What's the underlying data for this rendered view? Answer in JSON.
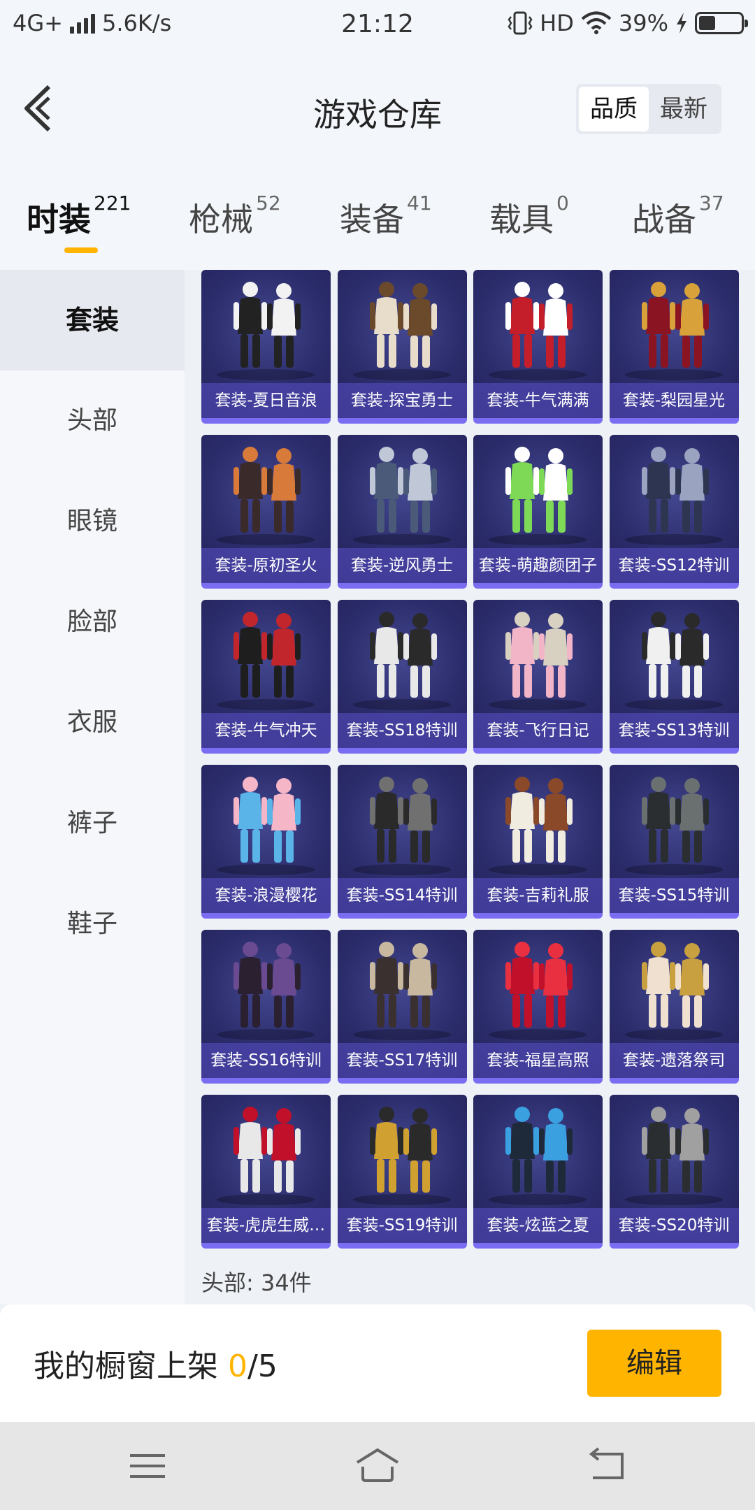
{
  "status_bar": {
    "network": "4G+",
    "speed": "5.6K/s",
    "time": "21:12",
    "hd": "HD",
    "battery": "39%",
    "battery_level": 0.39
  },
  "header": {
    "title": "游戏仓库",
    "sort_options": [
      "品质",
      "最新"
    ],
    "sort_active": "品质"
  },
  "tabs": [
    {
      "label": "时装",
      "count": "221",
      "active": true
    },
    {
      "label": "枪械",
      "count": "52"
    },
    {
      "label": "装备",
      "count": "41"
    },
    {
      "label": "载具",
      "count": "0"
    },
    {
      "label": "战备",
      "count": "37"
    }
  ],
  "sidebar": {
    "items": [
      "套装",
      "头部",
      "眼镜",
      "脸部",
      "衣服",
      "裤子",
      "鞋子"
    ],
    "active": "套装"
  },
  "items": [
    "套装-夏日音浪",
    "套装-探宝勇士",
    "套装-牛气满满",
    "套装-梨园星光",
    "套装-原初圣火",
    "套装-逆风勇士",
    "套装-萌趣颜团子",
    "套装-SS12特训",
    "套装-牛气冲天",
    "套装-SS18特训",
    "套装-飞行日记",
    "套装-SS13特训",
    "套装-浪漫樱花",
    "套装-SS14特训",
    "套装-吉莉礼服",
    "套装-SS15特训",
    "套装-SS16特训",
    "套装-SS17特训",
    "套装-福星高照",
    "套装-遗落祭司",
    "套装-虎虎生威…",
    "套装-SS19特训",
    "套装-炫蓝之夏",
    "套装-SS20特训"
  ],
  "figure_colors": [
    [
      "#222",
      "#f2f2f2"
    ],
    [
      "#e8dccb",
      "#6b4a2b"
    ],
    [
      "#c41e2a",
      "#ffffff"
    ],
    [
      "#8a1422",
      "#d9a13a"
    ],
    [
      "#3a2a2a",
      "#d77a3a"
    ],
    [
      "#4a5a78",
      "#c0c8d8"
    ],
    [
      "#7ed957",
      "#ffffff"
    ],
    [
      "#2e3550",
      "#9aa3c0"
    ],
    [
      "#1e1e1e",
      "#c0262c"
    ],
    [
      "#e8e8e8",
      "#2a2a2a"
    ],
    [
      "#f2b5c8",
      "#d8d0c0"
    ],
    [
      "#f0f0f0",
      "#2a2a2a"
    ],
    [
      "#5ab4e8",
      "#f5b6c8"
    ],
    [
      "#2a2a2a",
      "#707070"
    ],
    [
      "#f0ece0",
      "#8a4a2a"
    ],
    [
      "#2a2e30",
      "#6a7070"
    ],
    [
      "#2a2030",
      "#6a4a90"
    ],
    [
      "#3a3030",
      "#c8b8a0"
    ],
    [
      "#c0102a",
      "#e83040"
    ],
    [
      "#f0e0d0",
      "#c8a040"
    ],
    [
      "#e8e8e8",
      "#c0102a"
    ],
    [
      "#d0a030",
      "#2a2a2a"
    ],
    [
      "#1e2a3a",
      "#3aa0e0"
    ],
    [
      "#2a2e30",
      "#a0a0a0"
    ]
  ],
  "count_line": "头部: 34件",
  "bottom": {
    "shelf_label": "我的橱窗上架 ",
    "shelf_current": "0",
    "shelf_total": "/5",
    "edit_button": "编辑"
  },
  "colors": {
    "accent": "#ffb400",
    "card_bg": "#2b2c6b",
    "card_border": "#7a6df2"
  }
}
